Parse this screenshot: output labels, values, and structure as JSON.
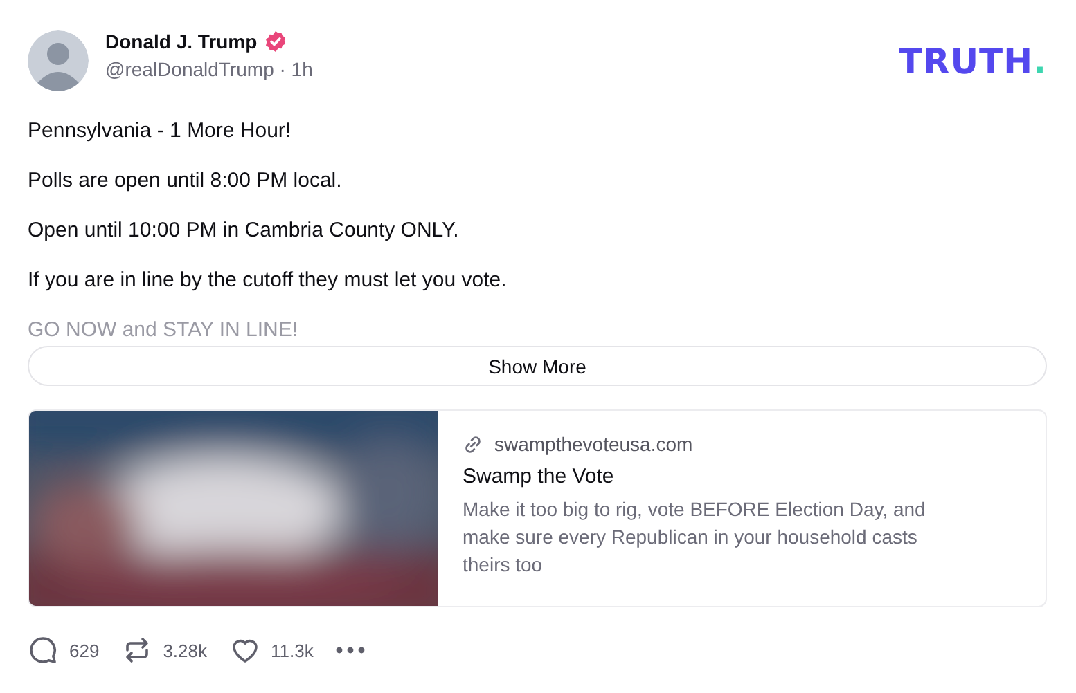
{
  "author": {
    "name": "Donald J. Trump",
    "verified": true,
    "handle": "@realDonaldTrump",
    "separator": "·",
    "time": "1h"
  },
  "logo": {
    "text": "TRUTH",
    "mark": "."
  },
  "paragraphs": [
    "Pennsylvania - 1 More Hour!",
    "Polls are open until 8:00 PM local.",
    "Open until 10:00 PM in Cambria County ONLY.",
    "If you are in line by the cutoff they must let you vote.",
    "GO NOW and STAY IN LINE!"
  ],
  "show_more": "Show More",
  "link_card": {
    "domain": "swampthevoteusa.com",
    "title": "Swamp the Vote",
    "description": "Make it too big to rig, vote BEFORE Election Day, and make sure every Republican in your household casts theirs too"
  },
  "actions": [
    {
      "kind": "reply",
      "count": "629"
    },
    {
      "kind": "repost",
      "count": "3.28k"
    },
    {
      "kind": "like",
      "count": "11.3k"
    },
    {
      "kind": "more"
    }
  ]
}
